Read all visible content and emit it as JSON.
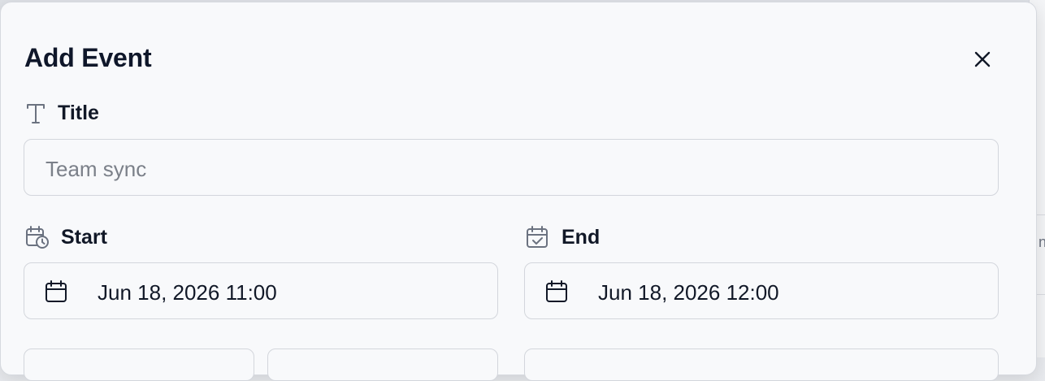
{
  "dialog": {
    "title": "Add Event",
    "close_icon": "close-icon"
  },
  "fields": {
    "title": {
      "label": "Title",
      "icon": "text-type-icon",
      "placeholder": "Team sync",
      "value": ""
    },
    "start": {
      "label": "Start",
      "icon": "calendar-clock-icon",
      "value": "Jun 18, 2026 11:00",
      "input_icon": "calendar-icon"
    },
    "end": {
      "label": "End",
      "icon": "calendar-check-icon",
      "value": "Jun 18, 2026 12:00",
      "input_icon": "calendar-icon"
    }
  }
}
